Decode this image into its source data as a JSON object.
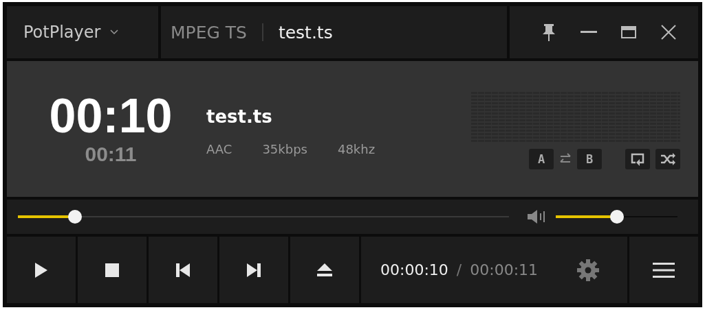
{
  "title_bar": {
    "app_menu": "PotPlayer",
    "format": "MPEG TS",
    "file_name": "test.ts",
    "pinned": false
  },
  "info": {
    "current_time": "00:10",
    "total_time": "00:11",
    "title": "test.ts",
    "codec": "AAC",
    "bitrate": "35kbps",
    "sample_rate": "48khz",
    "ab_buttons": [
      {
        "label": "A"
      },
      {
        "label": "B"
      }
    ]
  },
  "seek": {
    "level": 0.116
  },
  "volume": {
    "level": 0.5
  },
  "controls": [
    {
      "kind": "play"
    },
    {
      "kind": "stop"
    },
    {
      "kind": "prev"
    },
    {
      "kind": "next"
    },
    {
      "kind": "eject"
    }
  ],
  "time": {
    "elapsed": "00:00:10",
    "separator": "/",
    "duration": "00:00:11"
  }
}
